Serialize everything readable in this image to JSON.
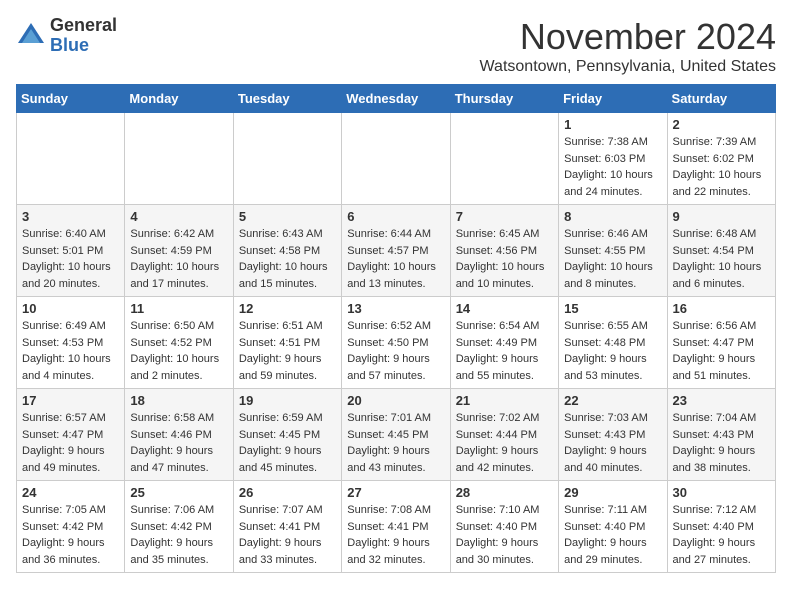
{
  "logo": {
    "general": "General",
    "blue": "Blue"
  },
  "header": {
    "month": "November 2024",
    "location": "Watsontown, Pennsylvania, United States"
  },
  "weekdays": [
    "Sunday",
    "Monday",
    "Tuesday",
    "Wednesday",
    "Thursday",
    "Friday",
    "Saturday"
  ],
  "weeks": [
    [
      {
        "day": "",
        "info": ""
      },
      {
        "day": "",
        "info": ""
      },
      {
        "day": "",
        "info": ""
      },
      {
        "day": "",
        "info": ""
      },
      {
        "day": "",
        "info": ""
      },
      {
        "day": "1",
        "info": "Sunrise: 7:38 AM\nSunset: 6:03 PM\nDaylight: 10 hours\nand 24 minutes."
      },
      {
        "day": "2",
        "info": "Sunrise: 7:39 AM\nSunset: 6:02 PM\nDaylight: 10 hours\nand 22 minutes."
      }
    ],
    [
      {
        "day": "3",
        "info": "Sunrise: 6:40 AM\nSunset: 5:01 PM\nDaylight: 10 hours\nand 20 minutes."
      },
      {
        "day": "4",
        "info": "Sunrise: 6:42 AM\nSunset: 4:59 PM\nDaylight: 10 hours\nand 17 minutes."
      },
      {
        "day": "5",
        "info": "Sunrise: 6:43 AM\nSunset: 4:58 PM\nDaylight: 10 hours\nand 15 minutes."
      },
      {
        "day": "6",
        "info": "Sunrise: 6:44 AM\nSunset: 4:57 PM\nDaylight: 10 hours\nand 13 minutes."
      },
      {
        "day": "7",
        "info": "Sunrise: 6:45 AM\nSunset: 4:56 PM\nDaylight: 10 hours\nand 10 minutes."
      },
      {
        "day": "8",
        "info": "Sunrise: 6:46 AM\nSunset: 4:55 PM\nDaylight: 10 hours\nand 8 minutes."
      },
      {
        "day": "9",
        "info": "Sunrise: 6:48 AM\nSunset: 4:54 PM\nDaylight: 10 hours\nand 6 minutes."
      }
    ],
    [
      {
        "day": "10",
        "info": "Sunrise: 6:49 AM\nSunset: 4:53 PM\nDaylight: 10 hours\nand 4 minutes."
      },
      {
        "day": "11",
        "info": "Sunrise: 6:50 AM\nSunset: 4:52 PM\nDaylight: 10 hours\nand 2 minutes."
      },
      {
        "day": "12",
        "info": "Sunrise: 6:51 AM\nSunset: 4:51 PM\nDaylight: 9 hours\nand 59 minutes."
      },
      {
        "day": "13",
        "info": "Sunrise: 6:52 AM\nSunset: 4:50 PM\nDaylight: 9 hours\nand 57 minutes."
      },
      {
        "day": "14",
        "info": "Sunrise: 6:54 AM\nSunset: 4:49 PM\nDaylight: 9 hours\nand 55 minutes."
      },
      {
        "day": "15",
        "info": "Sunrise: 6:55 AM\nSunset: 4:48 PM\nDaylight: 9 hours\nand 53 minutes."
      },
      {
        "day": "16",
        "info": "Sunrise: 6:56 AM\nSunset: 4:47 PM\nDaylight: 9 hours\nand 51 minutes."
      }
    ],
    [
      {
        "day": "17",
        "info": "Sunrise: 6:57 AM\nSunset: 4:47 PM\nDaylight: 9 hours\nand 49 minutes."
      },
      {
        "day": "18",
        "info": "Sunrise: 6:58 AM\nSunset: 4:46 PM\nDaylight: 9 hours\nand 47 minutes."
      },
      {
        "day": "19",
        "info": "Sunrise: 6:59 AM\nSunset: 4:45 PM\nDaylight: 9 hours\nand 45 minutes."
      },
      {
        "day": "20",
        "info": "Sunrise: 7:01 AM\nSunset: 4:45 PM\nDaylight: 9 hours\nand 43 minutes."
      },
      {
        "day": "21",
        "info": "Sunrise: 7:02 AM\nSunset: 4:44 PM\nDaylight: 9 hours\nand 42 minutes."
      },
      {
        "day": "22",
        "info": "Sunrise: 7:03 AM\nSunset: 4:43 PM\nDaylight: 9 hours\nand 40 minutes."
      },
      {
        "day": "23",
        "info": "Sunrise: 7:04 AM\nSunset: 4:43 PM\nDaylight: 9 hours\nand 38 minutes."
      }
    ],
    [
      {
        "day": "24",
        "info": "Sunrise: 7:05 AM\nSunset: 4:42 PM\nDaylight: 9 hours\nand 36 minutes."
      },
      {
        "day": "25",
        "info": "Sunrise: 7:06 AM\nSunset: 4:42 PM\nDaylight: 9 hours\nand 35 minutes."
      },
      {
        "day": "26",
        "info": "Sunrise: 7:07 AM\nSunset: 4:41 PM\nDaylight: 9 hours\nand 33 minutes."
      },
      {
        "day": "27",
        "info": "Sunrise: 7:08 AM\nSunset: 4:41 PM\nDaylight: 9 hours\nand 32 minutes."
      },
      {
        "day": "28",
        "info": "Sunrise: 7:10 AM\nSunset: 4:40 PM\nDaylight: 9 hours\nand 30 minutes."
      },
      {
        "day": "29",
        "info": "Sunrise: 7:11 AM\nSunset: 4:40 PM\nDaylight: 9 hours\nand 29 minutes."
      },
      {
        "day": "30",
        "info": "Sunrise: 7:12 AM\nSunset: 4:40 PM\nDaylight: 9 hours\nand 27 minutes."
      }
    ]
  ]
}
